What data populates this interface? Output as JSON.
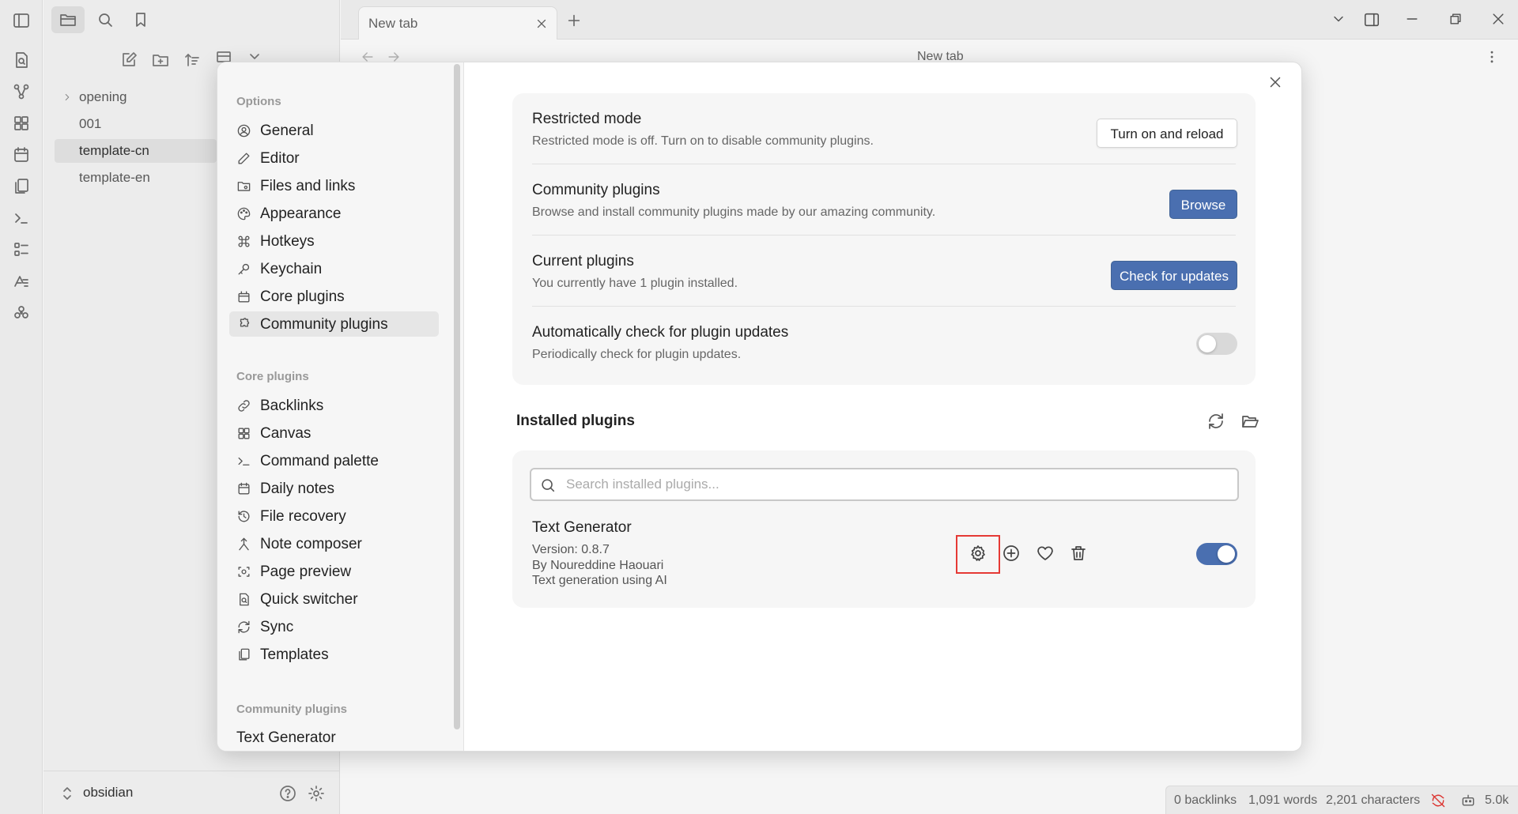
{
  "sidebar": {
    "tree": [
      {
        "label": "opening",
        "folder": true
      },
      {
        "label": "001",
        "folder": false
      },
      {
        "label": "template-cn",
        "folder": false,
        "active": true
      },
      {
        "label": "template-en",
        "folder": false
      }
    ],
    "vault_name": "obsidian"
  },
  "tab": {
    "title": "New tab",
    "header_title": "New tab"
  },
  "status": {
    "backlinks": "0 backlinks",
    "words": "1,091 words",
    "characters": "2,201 characters",
    "tokens": "5.0k"
  },
  "settings": {
    "groups": [
      {
        "label": "Options",
        "items": [
          "General",
          "Editor",
          "Files and links",
          "Appearance",
          "Hotkeys",
          "Keychain",
          "Core plugins",
          "Community plugins"
        ]
      },
      {
        "label": "Core plugins",
        "items": [
          "Backlinks",
          "Canvas",
          "Command palette",
          "Daily notes",
          "File recovery",
          "Note composer",
          "Page preview",
          "Quick switcher",
          "Sync",
          "Templates"
        ]
      },
      {
        "label": "Community plugins",
        "items": [
          "Text Generator"
        ]
      }
    ],
    "active_item": "Community plugins"
  },
  "content": {
    "rows": [
      {
        "name": "Restricted mode",
        "desc": "Restricted mode is off. Turn on to disable community plugins.",
        "button": "Turn on and reload"
      },
      {
        "name": "Community plugins",
        "desc": "Browse and install community plugins made by our amazing community.",
        "button": "Browse"
      },
      {
        "name": "Current plugins",
        "desc": "You currently have 1 plugin installed.",
        "button": "Check for updates"
      },
      {
        "name": "Automatically check for plugin updates",
        "desc": "Periodically check for plugin updates.",
        "toggle": false
      }
    ],
    "installed_heading": "Installed plugins",
    "search_placeholder": "Search installed plugins...",
    "plugin": {
      "name": "Text Generator",
      "version": "Version: 0.8.7",
      "author": "By Noureddine Haouari",
      "description": "Text generation using AI",
      "enabled": true
    }
  },
  "colors": {
    "accent": "#4a6fb0",
    "highlight": "#e53935"
  }
}
